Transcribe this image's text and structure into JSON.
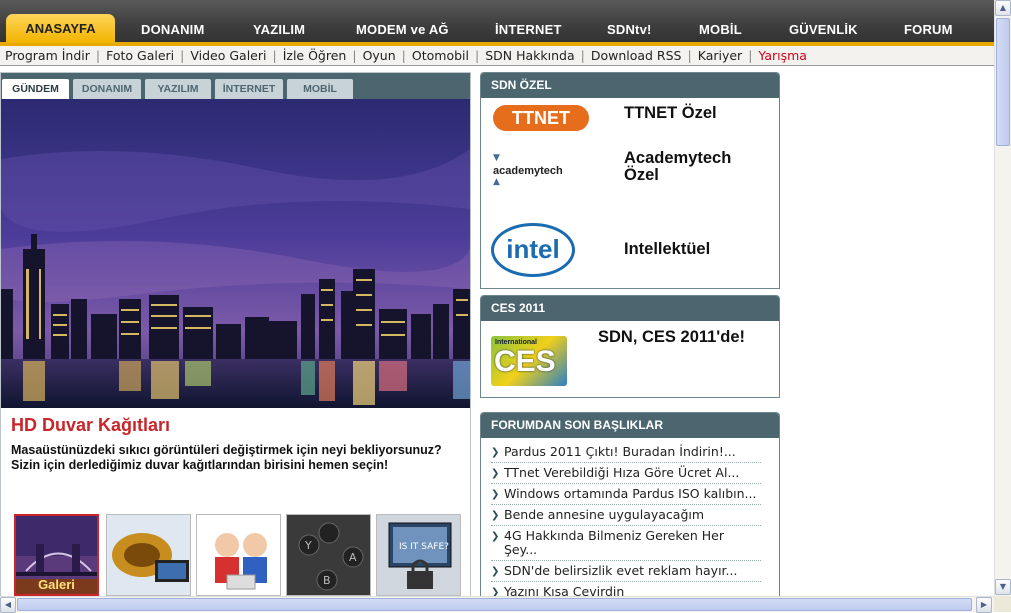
{
  "topnav": {
    "active": "ANASAYFA",
    "items": [
      "DONANIM",
      "YAZILIM",
      "MODEM ve AĞ",
      "İNTERNET",
      "SDNtv!",
      "MOBİL",
      "GÜVENLİK",
      "FORUM"
    ]
  },
  "subnav": {
    "items": [
      "Program İndir",
      "Foto Galeri",
      "Video Galeri",
      "İzle Öğren",
      "Oyun",
      "Otomobil",
      "SDN Hakkında",
      "Download RSS",
      "Kariyer",
      "Yarışma"
    ]
  },
  "featured": {
    "tabs": [
      "GÜNDEM",
      "DONANIM",
      "YAZILIM",
      "İNTERNET",
      "MOBİL"
    ],
    "title": "HD Duvar Kağıtları",
    "description": "Masaüstünüzdeki sıkıcı görüntüleri değiştirmek için neyi bekliyorsunuz? Sizin için derlediğimiz duvar kağıtlarından birisini hemen seçin!",
    "thumb_label": "Galeri"
  },
  "sdn_ozel": {
    "header": "SDN ÖZEL",
    "ttnet_logo": "TTNET",
    "ttnet": "TTNET Özel",
    "academy_logo": "academytech",
    "academy": "Academytech Özel",
    "intel_logo": "intel",
    "intel": "Intellektüel"
  },
  "ces": {
    "header": "CES 2011",
    "logo_top": "International",
    "logo_main": "CES",
    "title": "SDN, CES 2011'de!"
  },
  "forum": {
    "header": "FORUMDAN SON BAŞLIKLAR",
    "items": [
      "Pardus 2011 Çıktı! Buradan İndirin!...",
      "TTnet Verebildiği Hıza Göre Ücret Al...",
      "Windows ortamında Pardus ISO kalıbın...",
      "Bende annesine uygulayacağım",
      "4G Hakkında Bilmeniz Gereken Her Şey...",
      "SDN'de belirsizlik evet reklam hayır...",
      "Yazını Kısa Çevirdin"
    ]
  },
  "colors": {
    "accent": "#f2b400",
    "panel": "#4c6670",
    "title_red": "#c8262a"
  }
}
